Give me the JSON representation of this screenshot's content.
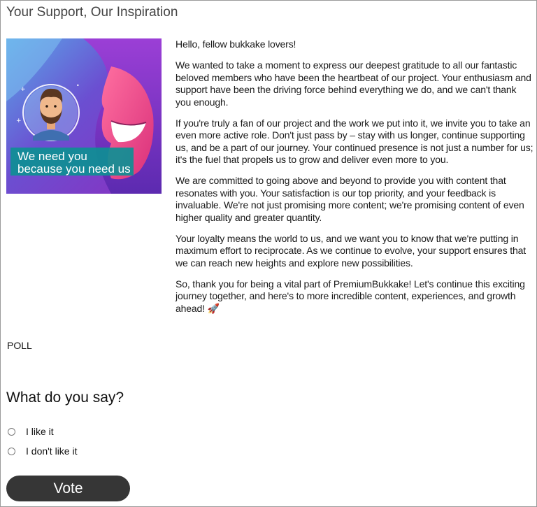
{
  "page": {
    "title": "Your Support, Our Inspiration"
  },
  "banner": {
    "line1": "We need you",
    "line2": "because you need us"
  },
  "article": {
    "paragraphs": [
      "Hello, fellow bukkake lovers!",
      "We wanted to take a moment to express our deepest gratitude to all our fantastic beloved members who have been the heartbeat of our project. Your enthusiasm and support have been the driving force behind everything we do, and we can't thank you enough.",
      "If you're truly a fan of our project and the work we put into it, we invite you to take an even more active role. Don't just pass by – stay with us longer, continue supporting us, and be a part of our journey. Your continued presence is not just a number for us; it's the fuel that propels us to grow and deliver even more to you.",
      "We are committed to going above and beyond to provide you with content that resonates with you. Your satisfaction is our top priority, and your feedback is invaluable. We're not just promising more content; we're promising content of even higher quality and greater quantity.",
      "Your loyalty means the world to us, and we want you to know that we're putting in maximum effort to reciprocate. As we continue to evolve, your support ensures that we can reach new heights and explore new possibilities.",
      "So, thank you for being a vital part of PremiumBukkake! Let's continue this exciting journey together, and here's to more incredible content, experiences, and growth ahead! 🚀"
    ]
  },
  "poll": {
    "label": "POLL",
    "question": "What do you say?",
    "options": [
      "I like it",
      "I don't like it"
    ],
    "vote_label": "Vote"
  },
  "colors": {
    "vote_button_bg": "#363636",
    "banner_teal": "#0e8f94",
    "banner_purple": "#7a2fb8",
    "banner_pink": "#ef4b8c"
  }
}
